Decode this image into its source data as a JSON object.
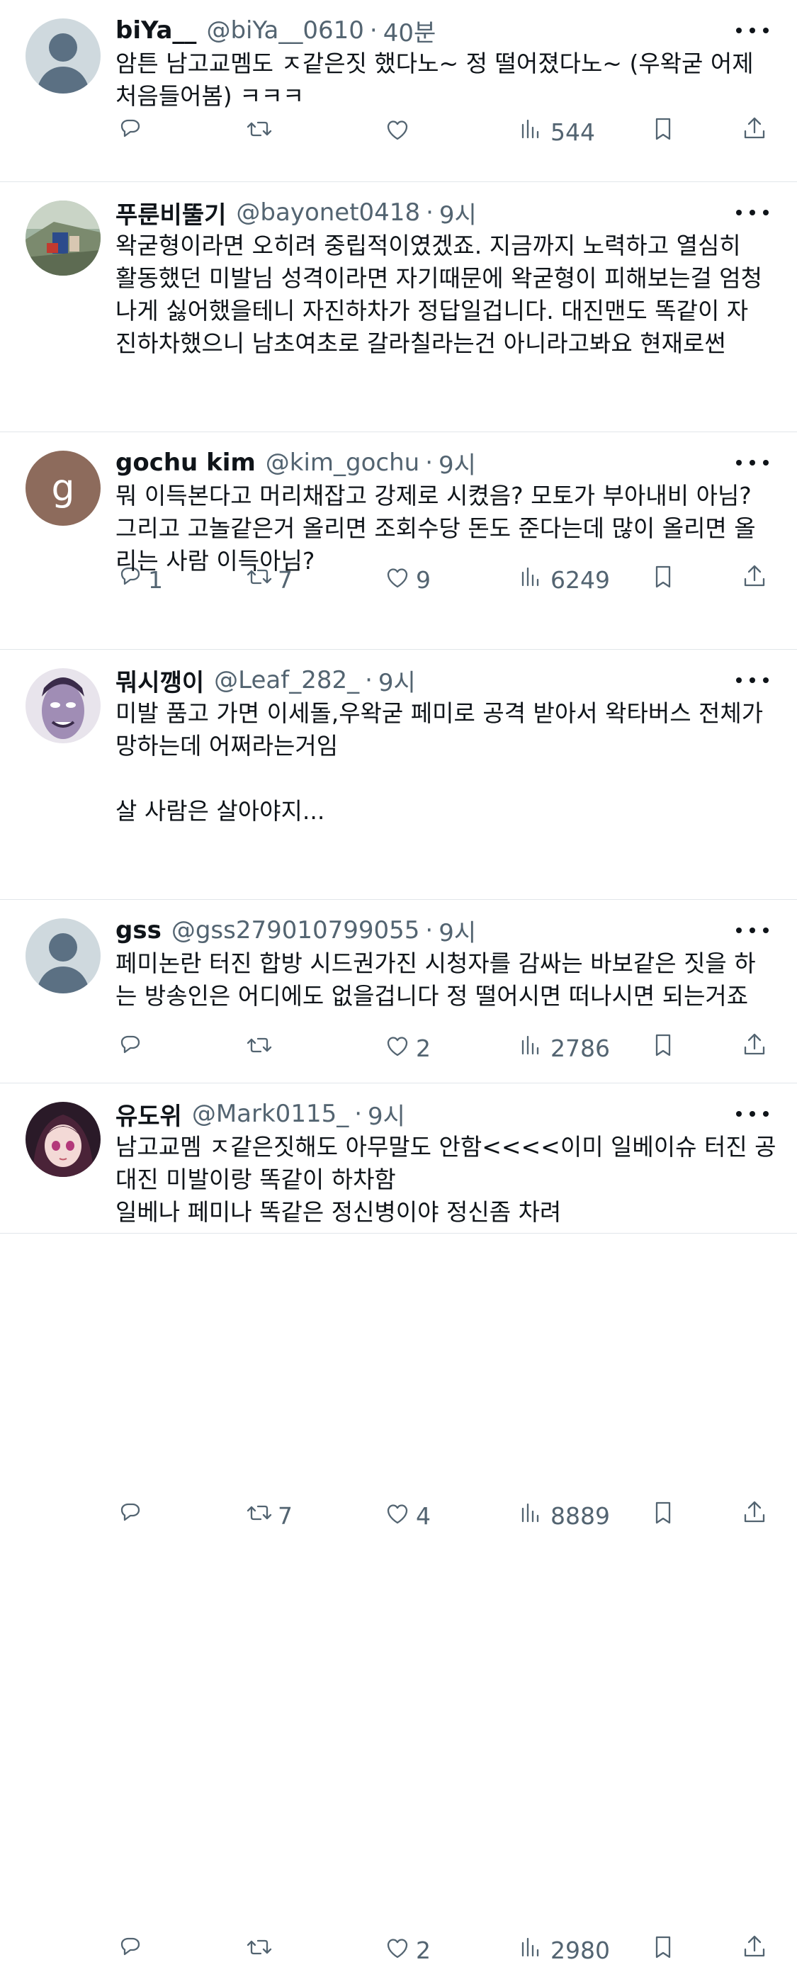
{
  "colors": {
    "text": "#0f1419",
    "secondary": "#536471",
    "divider": "#e1e6ea"
  },
  "tweets": [
    {
      "name": "biYa__",
      "handle": "@biYa__0610",
      "time": "40분",
      "avatar": "default-avatar",
      "lines": [
        "암튼 남고교멤도 ㅈ같은짓 했다노~ 정 떨어졌다노~ (우왁굳 어제",
        "처음들어봄) ㅋㅋㅋ"
      ],
      "replies": "",
      "retweets": "",
      "likes": "",
      "views": "544"
    },
    {
      "name": "푸룬비뚤기",
      "handle": "@bayonet0418",
      "time": "9시",
      "avatar": "photo-avatar",
      "lines": [
        "왁굳형이라면  오히려 중립적이였겠죠. 지금까지 노력하고 열심히",
        "활동했던 미발님 성격이라면 자기때문에 왁굳형이 피해보는걸 엄청",
        "나게 싫어했을테니 자진하차가 정답일겁니다. 대진맨도 똑같이 자",
        "진하차했으니 남초여초로 갈라칠라는건 아니라고봐요 현재로썬"
      ],
      "replies": "1",
      "retweets": "7",
      "likes": "9",
      "views": "6249"
    },
    {
      "name": "gochu kim",
      "handle": "@kim_gochu",
      "time": "9시",
      "avatar": "letter-avatar",
      "avatar_letter": "g",
      "lines": [
        "뭐 이득본다고 머리채잡고 강제로 시켰음? 모토가 부아내비 아님?",
        "그리고 고놀같은거 올리면 조회수당 돈도 준다는데 많이 올리면 올",
        "리는 사람 이득아님?"
      ],
      "replies": "",
      "retweets": "",
      "likes": "2",
      "views": "2786"
    },
    {
      "name": "뭐시깽이",
      "handle": "@Leaf_282_",
      "time": "9시",
      "avatar": "cartoon-avatar",
      "lines": [
        "미발 품고 가면 이세돌,우왁굳 페미로 공격 받아서 왁타버스 전체가",
        "망하는데 어쩌라는거임",
        "",
        "살 사람은 살아야지..."
      ],
      "replies": "",
      "retweets": "7",
      "likes": "4",
      "views": "8889"
    },
    {
      "name": "gss",
      "handle": "@gss279010799055",
      "time": "9시",
      "avatar": "default-avatar",
      "lines": [
        "페미논란 터진 합방 시드권가진 시청자를 감싸는 바보같은 짓을 하",
        "는 방송인은 어디에도 없을겁니다 정 떨어시면 떠나시면 되는거죠"
      ],
      "replies": "",
      "retweets": "",
      "likes": "2",
      "views": "2980"
    },
    {
      "name": "유도위",
      "handle": "@Mark0115_",
      "time": "9시",
      "avatar": "anime-avatar",
      "lines": [
        "남고교멤 ㅈ같은짓해도 아무말도 안함<<<<이미 일베이슈 터진 공",
        "대진 미발이랑 똑같이 하차함",
        "일베나 페미나 똑같은 정신병이야 정신좀 차려"
      ],
      "replies": "",
      "retweets": "",
      "likes": "",
      "views": ""
    }
  ]
}
